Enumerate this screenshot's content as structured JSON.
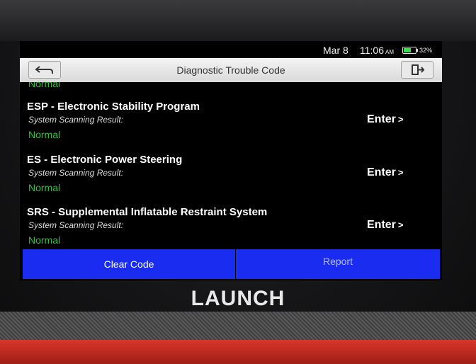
{
  "status": {
    "date": "Mar 8",
    "time": "11:06",
    "ampm": "AM",
    "battery": "32%"
  },
  "header": {
    "title": "Diagnostic Trouble Code"
  },
  "top_item_status": "Normal",
  "systems": [
    {
      "title": "ESP - Electronic Stability Program",
      "subtitle": "System Scanning Result:",
      "status": "Normal",
      "action": "Enter"
    },
    {
      "title": "ES - Electronic Power Steering",
      "subtitle": "System Scanning Result:",
      "status": "Normal",
      "action": "Enter"
    },
    {
      "title": "SRS - Supplemental Inflatable Restraint System",
      "subtitle": "System Scanning Result:",
      "status": "Normal",
      "action": "Enter"
    }
  ],
  "footer": {
    "clear_label": "Clear Code",
    "report_label": "Report"
  },
  "device": {
    "brand": "LAUNCH"
  },
  "colors": {
    "accent_blue": "#1a2cf0",
    "ok_green": "#2fc23d",
    "bezel_red": "#c92f25"
  },
  "icons": {
    "back": "back-arrow-icon",
    "exit": "exit-icon",
    "battery": "battery-icon"
  }
}
